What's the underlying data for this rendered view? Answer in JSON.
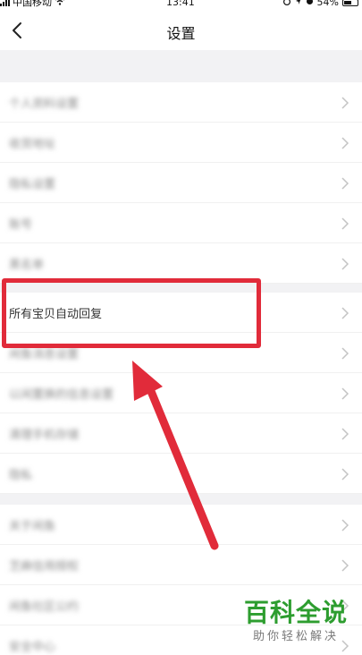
{
  "status_bar": {
    "carrier": "中国移动",
    "time": "13:41",
    "battery": "54%"
  },
  "nav": {
    "title": "设置"
  },
  "groups": [
    {
      "items": [
        {
          "label": "个人资料设置"
        },
        {
          "label": "收货地址"
        },
        {
          "label": "隐私设置"
        },
        {
          "label": "账号"
        },
        {
          "label": "黑名单"
        }
      ]
    },
    {
      "items": [
        {
          "label": "所有宝贝自动回复"
        },
        {
          "label": "闲鱼消息设置"
        },
        {
          "label": "以闲置换的信息设置"
        },
        {
          "label": "清理手机存储"
        },
        {
          "label": "隐私"
        }
      ]
    },
    {
      "items": [
        {
          "label": "关于闲鱼"
        },
        {
          "label": "芝麻信用授权"
        },
        {
          "label": "闲鱼社区公约"
        },
        {
          "label": "安全中心"
        }
      ]
    }
  ],
  "watermark": {
    "title": "百科全说",
    "subtitle": "助你轻松解决"
  },
  "colors": {
    "highlight": "#e12b3a",
    "watermark_green": "#2d9d2f"
  }
}
